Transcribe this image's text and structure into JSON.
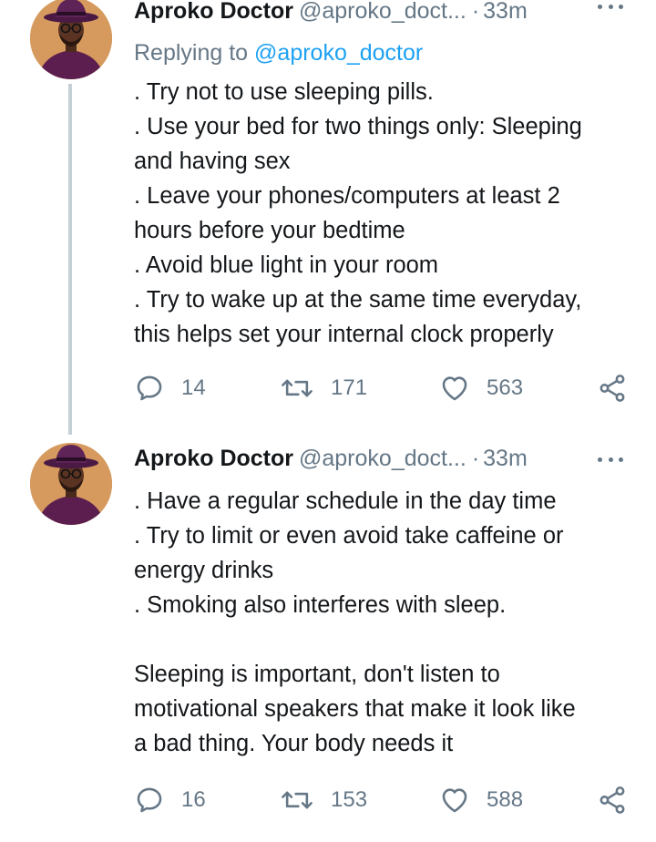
{
  "colors": {
    "text": "#14171a",
    "secondary": "#657786",
    "accent": "#1da1f2",
    "connector": "#c4cfd6"
  },
  "tweets": [
    {
      "author_name": "Aproko Doctor",
      "author_handle": "@aproko_doct...",
      "separator": "·",
      "time": "33m",
      "replying_prefix": "Replying to",
      "replying_handle": "@aproko_doctor",
      "lines": [
        ". Try not to use sleeping pills.",
        ". Use your bed for two things only: Sleeping",
        "and having sex",
        ". Leave your phones/computers at least 2",
        "hours before your bedtime",
        ". Avoid blue light in your room",
        ". Try to wake up at the same time everyday,",
        "this helps set your internal clock properly"
      ],
      "icons": {
        "reply": "reply-icon",
        "retweet": "retweet-icon",
        "like": "heart-icon",
        "share": "share-icon",
        "more": "more-icon"
      },
      "reply_count": "14",
      "retweet_count": "171",
      "like_count": "563"
    },
    {
      "author_name": "Aproko Doctor",
      "author_handle": "@aproko_doct...",
      "separator": "·",
      "time": "33m",
      "lines": [
        ". Have a regular schedule in the day time",
        ". Try to limit or even avoid take caffeine or",
        "energy drinks",
        ". Smoking also interferes with sleep.",
        "",
        "Sleeping is important, don't listen to",
        "motivational speakers that make it look like",
        "a bad thing. Your body needs it"
      ],
      "icons": {
        "reply": "reply-icon",
        "retweet": "retweet-icon",
        "like": "heart-icon",
        "share": "share-icon",
        "more": "more-icon"
      },
      "reply_count": "16",
      "retweet_count": "153",
      "like_count": "588"
    }
  ]
}
